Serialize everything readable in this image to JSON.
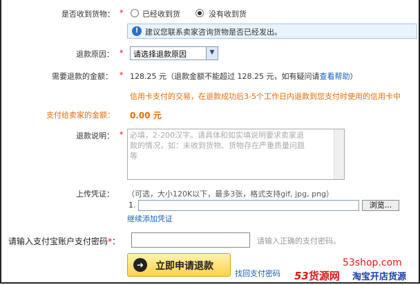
{
  "received": {
    "label": "是否收到货物：",
    "req": "*",
    "option_yes": "已经收到货",
    "option_no": "没有收到货",
    "tip_icon": "!",
    "tip": "建议您联系卖家咨询货物是否已经发出。"
  },
  "reason": {
    "label": "退款原因：",
    "req": "*",
    "selected": "请选择退款原因",
    "arrow": "▼"
  },
  "amount": {
    "label": "需要退款的金额：",
    "req": "*",
    "value_text": "128.25 元（退款金额不能超过  128.25 元，如有疑问请",
    "help_link": "查看帮助",
    "help_close": "）",
    "credit_note": "信用卡支付的交易，在退款成功后3-5个工作日内退款到您支付时使用的信用卡中"
  },
  "seller": {
    "label": "支付给卖家的金额：",
    "value": "0.00 元"
  },
  "desc": {
    "label": "退款说明：",
    "req": "*",
    "placeholder": "必填，2-200汉字。请具体和如实填说明要求卖家退款的情况，如：未收到货物、货物存在严重质量问题等"
  },
  "upload": {
    "label": "上传凭证：",
    "hint": "（可选，大小120K以下，最多3张，格式支持gif, jpg, png）",
    "index": "1.",
    "browse": "浏览...",
    "add_more": "继续添加凭证"
  },
  "password": {
    "label": "请输入支付宝账户支付密码",
    "req": "*",
    "colon": "：",
    "hint": "请输入正确的支付密码。"
  },
  "submit": {
    "label": "立即申请退款",
    "icon": "➜"
  },
  "forgot": "找回支付密码",
  "watermark": {
    "site": "53shop.com",
    "brand_num": "53",
    "brand_text": "货源网",
    "slogan": "淘宝开店货源"
  },
  "colors": {
    "required": "#e00000",
    "orange_label": "#e86c00",
    "link": "#1a5fb4",
    "tip_bg": "#eaf4fc"
  }
}
